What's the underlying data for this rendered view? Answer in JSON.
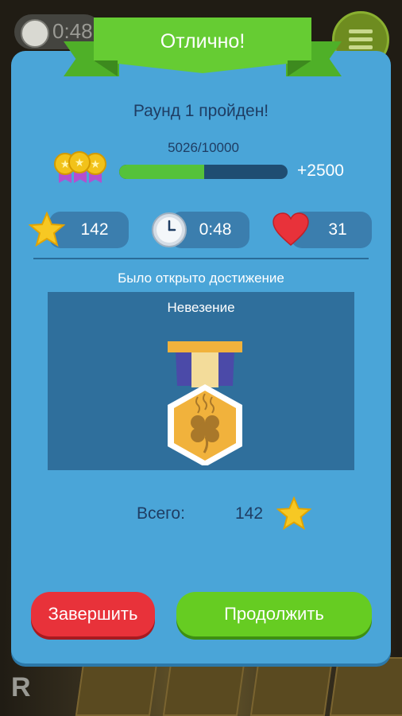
{
  "background": {
    "timer": "0:48",
    "bottom_letter": "R"
  },
  "dialog": {
    "title": "Отлично!",
    "round_text": "Раунд 1 пройден!",
    "score": {
      "text": "5026/10000",
      "current": 5026,
      "target": 10000,
      "bonus": "+2500"
    },
    "stats": {
      "stars": "142",
      "time": "0:48",
      "lives": "31"
    },
    "achievement": {
      "header": "Было открыто достижение",
      "name": "Невезение",
      "icon": "unlucky-clover-medal-icon"
    },
    "total": {
      "label": "Всего:",
      "value": "142"
    },
    "buttons": {
      "finish": "Завершить",
      "continue": "Продолжить"
    }
  },
  "colors": {
    "panel": "#4aa5d8",
    "ribbon": "#66cc33",
    "finish_button": "#e8323a",
    "continue_button": "#66cc22",
    "progress_fill": "#55c23a",
    "medal_gold": "#f2c21a"
  }
}
